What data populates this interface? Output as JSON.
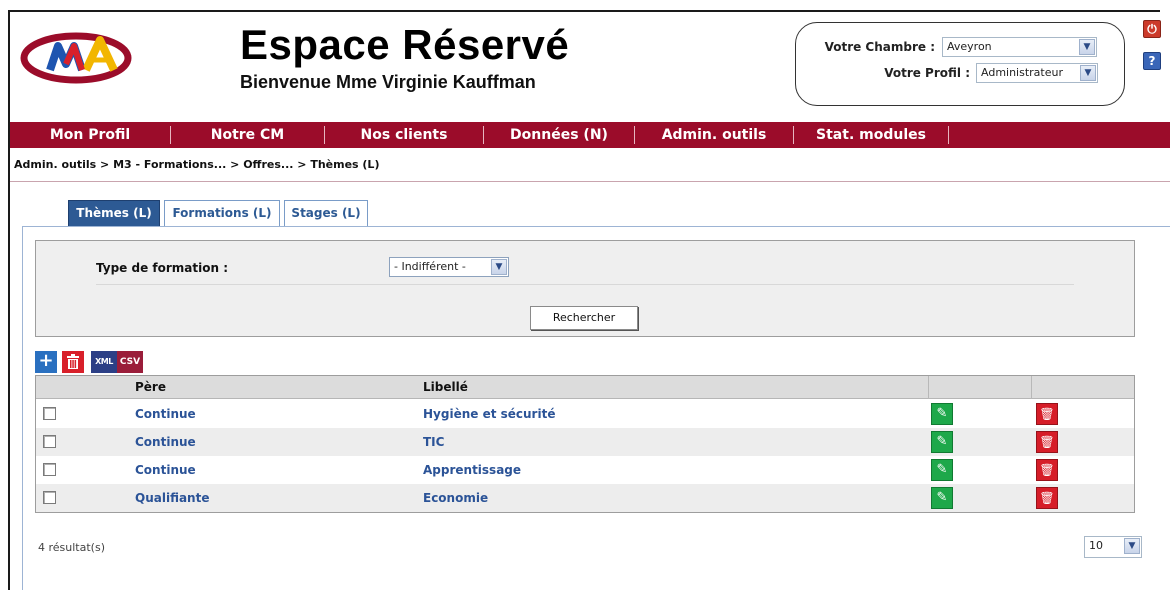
{
  "header": {
    "title": "Espace Réservé",
    "welcome": "Bienvenue  Mme Virginie Kauffman",
    "chamber_label": "Votre Chambre :",
    "chamber_value": "Aveyron",
    "profile_label": "Votre Profil :",
    "profile_value": "Administrateur"
  },
  "nav": {
    "items": [
      "Mon Profil",
      "Notre CM",
      "Nos clients",
      "Données (N)",
      "Admin. outils",
      "Stat. modules"
    ],
    "color": "#9b0c2a"
  },
  "breadcrumb": "Admin. outils > M3 - Formations... > Offres... > Thèmes (L)",
  "tabs": [
    "Thèmes (L)",
    "Formations (L)",
    "Stages (L)"
  ],
  "filter": {
    "label": "Type de formation :",
    "value": "- Indifférent -",
    "search_label": "Rechercher"
  },
  "toolbar": {
    "add_icon": "+",
    "delete_icon": "trash",
    "xml_label": "XML",
    "csv_label": "CSV"
  },
  "table": {
    "headers": [
      "Père",
      "Libellé"
    ],
    "rows": [
      {
        "pere": "Continue",
        "libelle": "Hygiène et sécurité"
      },
      {
        "pere": "Continue",
        "libelle": "TIC"
      },
      {
        "pere": "Continue",
        "libelle": "Apprentissage"
      },
      {
        "pere": "Qualifiante",
        "libelle": "Economie"
      }
    ]
  },
  "footer": {
    "count": "4 résultat(s)",
    "page_size": "10"
  },
  "icons": {
    "power": "power-icon",
    "help": "?",
    "edit": "pencil-icon",
    "trash": "trash-icon"
  }
}
